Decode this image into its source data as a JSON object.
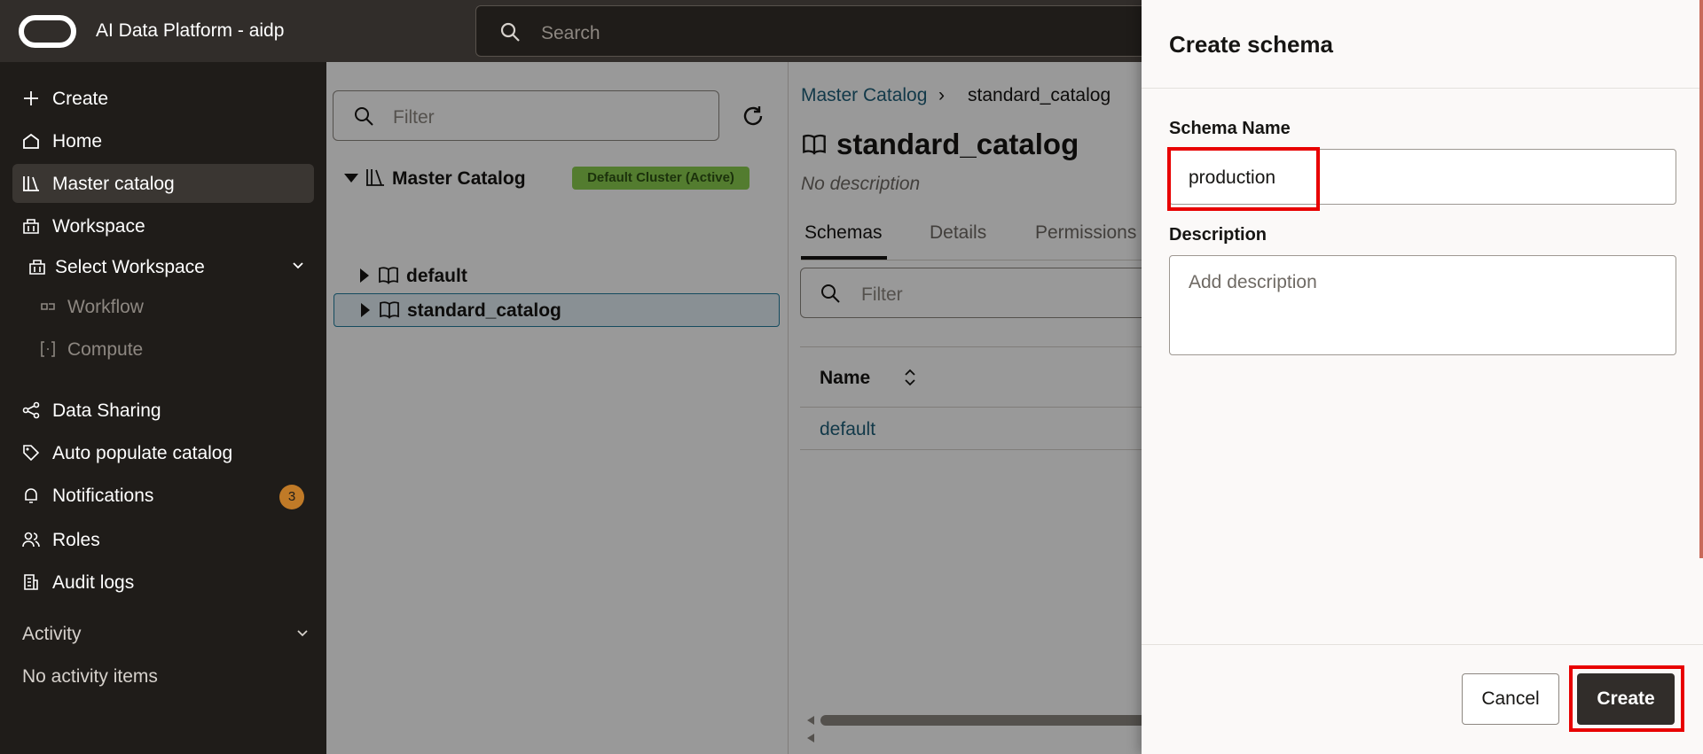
{
  "topbar": {
    "app_title": "AI Data Platform - aidp",
    "search_placeholder": "Search"
  },
  "sidebar": {
    "items": [
      {
        "label": "Create",
        "icon": "plus-icon"
      },
      {
        "label": "Home",
        "icon": "home-icon"
      },
      {
        "label": "Master catalog",
        "icon": "catalog-icon",
        "active": true
      },
      {
        "label": "Workspace",
        "icon": "workspace-icon"
      },
      {
        "label": "Select Workspace",
        "icon": "workspace-icon"
      },
      {
        "label": "Workflow",
        "icon": "workflow-icon"
      },
      {
        "label": "Compute",
        "icon": "compute-icon"
      },
      {
        "label": "Data Sharing",
        "icon": "share-icon"
      },
      {
        "label": "Auto populate catalog",
        "icon": "tag-icon"
      },
      {
        "label": "Notifications",
        "icon": "bell-icon",
        "badge": "3"
      },
      {
        "label": "Roles",
        "icon": "roles-icon"
      },
      {
        "label": "Audit logs",
        "icon": "audit-icon"
      }
    ],
    "activity_header": "Activity",
    "activity_empty": "No activity items"
  },
  "tree": {
    "filter_placeholder": "Filter",
    "root_label": "Master Catalog",
    "cluster_badge": "Default Cluster (Active)",
    "children": [
      "default",
      "standard_catalog"
    ]
  },
  "detail": {
    "breadcrumb": [
      "Master Catalog",
      "standard_catalog"
    ],
    "breadcrumb_sep": "›",
    "title": "standard_catalog",
    "description": "No description",
    "tabs": [
      "Schemas",
      "Details",
      "Permissions"
    ],
    "filter_placeholder": "Filter",
    "column_name": "Name",
    "rows": [
      "default"
    ]
  },
  "drawer": {
    "title": "Create schema",
    "schema_name_label": "Schema Name",
    "schema_name_value": "production",
    "description_label": "Description",
    "description_placeholder": "Add description",
    "cancel_label": "Cancel",
    "create_label": "Create"
  },
  "colors": {
    "highlight": "#e80000",
    "primary_button": "#312d2a",
    "link": "#1f5f7a",
    "badge": "#c07a27",
    "cluster_badge": "#8bcf4f"
  }
}
